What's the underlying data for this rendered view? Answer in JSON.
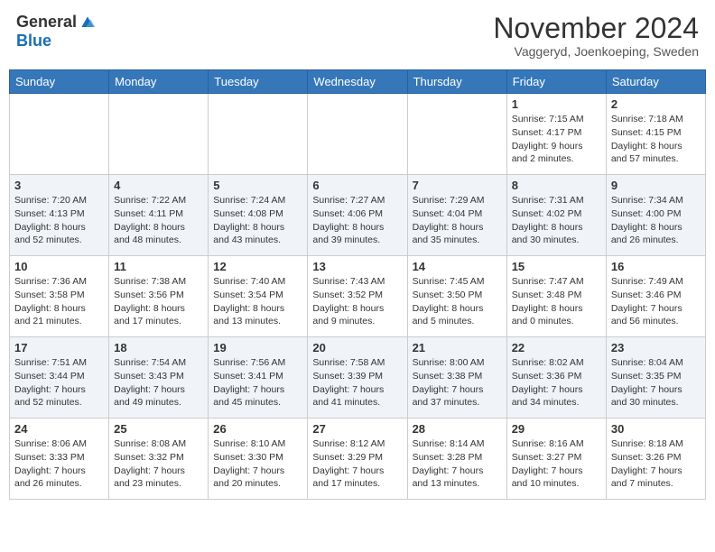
{
  "logo": {
    "general": "General",
    "blue": "Blue"
  },
  "header": {
    "month": "November 2024",
    "location": "Vaggeryd, Joenkoeping, Sweden"
  },
  "days_of_week": [
    "Sunday",
    "Monday",
    "Tuesday",
    "Wednesday",
    "Thursday",
    "Friday",
    "Saturday"
  ],
  "weeks": [
    [
      {
        "day": "",
        "info": ""
      },
      {
        "day": "",
        "info": ""
      },
      {
        "day": "",
        "info": ""
      },
      {
        "day": "",
        "info": ""
      },
      {
        "day": "",
        "info": ""
      },
      {
        "day": "1",
        "info": "Sunrise: 7:15 AM\nSunset: 4:17 PM\nDaylight: 9 hours\nand 2 minutes."
      },
      {
        "day": "2",
        "info": "Sunrise: 7:18 AM\nSunset: 4:15 PM\nDaylight: 8 hours\nand 57 minutes."
      }
    ],
    [
      {
        "day": "3",
        "info": "Sunrise: 7:20 AM\nSunset: 4:13 PM\nDaylight: 8 hours\nand 52 minutes."
      },
      {
        "day": "4",
        "info": "Sunrise: 7:22 AM\nSunset: 4:11 PM\nDaylight: 8 hours\nand 48 minutes."
      },
      {
        "day": "5",
        "info": "Sunrise: 7:24 AM\nSunset: 4:08 PM\nDaylight: 8 hours\nand 43 minutes."
      },
      {
        "day": "6",
        "info": "Sunrise: 7:27 AM\nSunset: 4:06 PM\nDaylight: 8 hours\nand 39 minutes."
      },
      {
        "day": "7",
        "info": "Sunrise: 7:29 AM\nSunset: 4:04 PM\nDaylight: 8 hours\nand 35 minutes."
      },
      {
        "day": "8",
        "info": "Sunrise: 7:31 AM\nSunset: 4:02 PM\nDaylight: 8 hours\nand 30 minutes."
      },
      {
        "day": "9",
        "info": "Sunrise: 7:34 AM\nSunset: 4:00 PM\nDaylight: 8 hours\nand 26 minutes."
      }
    ],
    [
      {
        "day": "10",
        "info": "Sunrise: 7:36 AM\nSunset: 3:58 PM\nDaylight: 8 hours\nand 21 minutes."
      },
      {
        "day": "11",
        "info": "Sunrise: 7:38 AM\nSunset: 3:56 PM\nDaylight: 8 hours\nand 17 minutes."
      },
      {
        "day": "12",
        "info": "Sunrise: 7:40 AM\nSunset: 3:54 PM\nDaylight: 8 hours\nand 13 minutes."
      },
      {
        "day": "13",
        "info": "Sunrise: 7:43 AM\nSunset: 3:52 PM\nDaylight: 8 hours\nand 9 minutes."
      },
      {
        "day": "14",
        "info": "Sunrise: 7:45 AM\nSunset: 3:50 PM\nDaylight: 8 hours\nand 5 minutes."
      },
      {
        "day": "15",
        "info": "Sunrise: 7:47 AM\nSunset: 3:48 PM\nDaylight: 8 hours\nand 0 minutes."
      },
      {
        "day": "16",
        "info": "Sunrise: 7:49 AM\nSunset: 3:46 PM\nDaylight: 7 hours\nand 56 minutes."
      }
    ],
    [
      {
        "day": "17",
        "info": "Sunrise: 7:51 AM\nSunset: 3:44 PM\nDaylight: 7 hours\nand 52 minutes."
      },
      {
        "day": "18",
        "info": "Sunrise: 7:54 AM\nSunset: 3:43 PM\nDaylight: 7 hours\nand 49 minutes."
      },
      {
        "day": "19",
        "info": "Sunrise: 7:56 AM\nSunset: 3:41 PM\nDaylight: 7 hours\nand 45 minutes."
      },
      {
        "day": "20",
        "info": "Sunrise: 7:58 AM\nSunset: 3:39 PM\nDaylight: 7 hours\nand 41 minutes."
      },
      {
        "day": "21",
        "info": "Sunrise: 8:00 AM\nSunset: 3:38 PM\nDaylight: 7 hours\nand 37 minutes."
      },
      {
        "day": "22",
        "info": "Sunrise: 8:02 AM\nSunset: 3:36 PM\nDaylight: 7 hours\nand 34 minutes."
      },
      {
        "day": "23",
        "info": "Sunrise: 8:04 AM\nSunset: 3:35 PM\nDaylight: 7 hours\nand 30 minutes."
      }
    ],
    [
      {
        "day": "24",
        "info": "Sunrise: 8:06 AM\nSunset: 3:33 PM\nDaylight: 7 hours\nand 26 minutes."
      },
      {
        "day": "25",
        "info": "Sunrise: 8:08 AM\nSunset: 3:32 PM\nDaylight: 7 hours\nand 23 minutes."
      },
      {
        "day": "26",
        "info": "Sunrise: 8:10 AM\nSunset: 3:30 PM\nDaylight: 7 hours\nand 20 minutes."
      },
      {
        "day": "27",
        "info": "Sunrise: 8:12 AM\nSunset: 3:29 PM\nDaylight: 7 hours\nand 17 minutes."
      },
      {
        "day": "28",
        "info": "Sunrise: 8:14 AM\nSunset: 3:28 PM\nDaylight: 7 hours\nand 13 minutes."
      },
      {
        "day": "29",
        "info": "Sunrise: 8:16 AM\nSunset: 3:27 PM\nDaylight: 7 hours\nand 10 minutes."
      },
      {
        "day": "30",
        "info": "Sunrise: 8:18 AM\nSunset: 3:26 PM\nDaylight: 7 hours\nand 7 minutes."
      }
    ]
  ]
}
